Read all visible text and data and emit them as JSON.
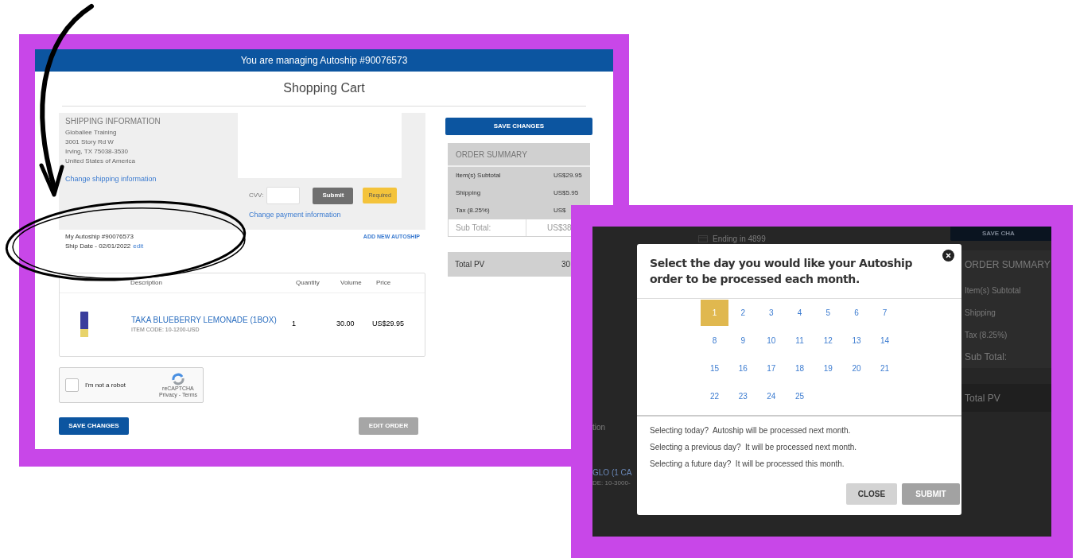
{
  "left_screenshot": {
    "banner": "You are managing Autoship #90076573",
    "title": "Shopping Cart",
    "shipping": {
      "heading": "SHIPPING INFORMATION",
      "lines": [
        "Globallee Training",
        "3001 Story Rd W",
        "Irving, TX 75038-3530",
        "United States of America"
      ],
      "link": "Change shipping information"
    },
    "payment": {
      "cvv_label": "CVV:",
      "submit": "Submit",
      "required_tag": "Required",
      "link": "Change payment information"
    },
    "autoship": {
      "name": "My Autoship #90076573",
      "ship_date": "Ship Date - 02/01/2022",
      "edit": "edit",
      "add_new": "ADD NEW AUTOSHIP"
    },
    "table": {
      "columns": [
        "Description",
        "Quantity",
        "Volume",
        "Price"
      ],
      "rows": [
        {
          "name": "TAKA BLUEBERRY LEMONADE (1BOX)",
          "item_code": "ITEM CODE: 10-1200-USD",
          "quantity": "1",
          "volume": "30.00",
          "price": "US$29.95"
        }
      ]
    },
    "captcha": {
      "label": "I'm not a robot",
      "checked": false,
      "brand": "reCAPTCHA",
      "links": "Privacy - Terms"
    },
    "save_button": "SAVE CHANGES",
    "edit_button": "EDIT ORDER",
    "summary": {
      "save_button": "SAVE CHANGES",
      "heading": "ORDER SUMMARY",
      "rows": [
        {
          "label": "Item(s) Subtotal",
          "value": "US$29.95"
        },
        {
          "label": "Shipping",
          "value": "US$5.95"
        },
        {
          "label": "Tax (8.25%)",
          "value": "US$"
        }
      ],
      "subtotal": {
        "label": "Sub Total:",
        "value": "US$38"
      },
      "total_pv": {
        "label": "Total PV",
        "value": "30"
      }
    }
  },
  "right_screenshot": {
    "background": {
      "card_text": "Ending in 4899",
      "save_button": "SAVE CHA",
      "summary_heading": "ORDER SUMMARY",
      "summary_rows": [
        "Item(s) Subtotal",
        "Shipping",
        "Tax (8.25%)",
        "Sub Total:"
      ],
      "total_pv": "Total PV",
      "column_text": "tion",
      "product_name": "GLO (1 CA",
      "product_code": "DE: 10-3000-"
    },
    "modal": {
      "title": "Select the day you would like your Autoship order to be processed each month.",
      "days": [
        {
          "label": "1",
          "selected": true
        },
        {
          "label": "2",
          "selected": false
        },
        {
          "label": "3",
          "selected": false
        },
        {
          "label": "4",
          "selected": false
        },
        {
          "label": "5",
          "selected": false
        },
        {
          "label": "6",
          "selected": false
        },
        {
          "label": "7",
          "selected": false
        },
        {
          "label": "8",
          "selected": false
        },
        {
          "label": "9",
          "selected": false
        },
        {
          "label": "10",
          "selected": false
        },
        {
          "label": "11",
          "selected": false
        },
        {
          "label": "12",
          "selected": false
        },
        {
          "label": "13",
          "selected": false
        },
        {
          "label": "14",
          "selected": false
        },
        {
          "label": "15",
          "selected": false
        },
        {
          "label": "16",
          "selected": false
        },
        {
          "label": "17",
          "selected": false
        },
        {
          "label": "18",
          "selected": false
        },
        {
          "label": "19",
          "selected": false
        },
        {
          "label": "20",
          "selected": false
        },
        {
          "label": "21",
          "selected": false
        },
        {
          "label": "22",
          "selected": false
        },
        {
          "label": "23",
          "selected": false
        },
        {
          "label": "24",
          "selected": false
        },
        {
          "label": "25",
          "selected": false
        }
      ],
      "notes": [
        "Selecting today?  Autoship will be processed next month.",
        "Selecting a previous day?  It will be processed next month.",
        "Selecting a future day?  It will be processed this month."
      ],
      "close_button": "CLOSE",
      "submit_button": "SUBMIT"
    }
  }
}
